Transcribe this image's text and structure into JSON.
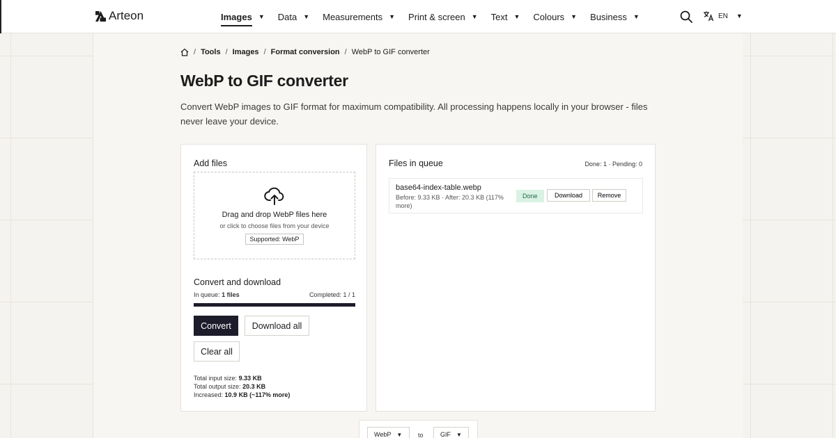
{
  "brand": {
    "name": "Arteon"
  },
  "nav": {
    "items": [
      {
        "label": "Images",
        "active": true
      },
      {
        "label": "Data"
      },
      {
        "label": "Measurements"
      },
      {
        "label": "Print & screen"
      },
      {
        "label": "Text"
      },
      {
        "label": "Colours"
      },
      {
        "label": "Business"
      }
    ],
    "caret": "▼"
  },
  "language": {
    "code": "EN"
  },
  "breadcrumb": {
    "sep": "/",
    "items": [
      "Tools",
      "Images",
      "Format conversion",
      "WebP to GIF converter"
    ]
  },
  "page": {
    "title": "WebP to GIF converter",
    "description": "Convert WebP images to GIF format for maximum compatibility. All processing happens locally in your browser - files never leave your device."
  },
  "add_files": {
    "title": "Add files",
    "drop_title": "Drag and drop WebP files here",
    "drop_sub": "or click to choose files from your device",
    "supported": "Supported: WebP"
  },
  "convert": {
    "title": "Convert and download",
    "in_queue_label": "In queue:",
    "in_queue_value": "1 files",
    "completed_label": "Completed:",
    "completed_value": "1 / 1",
    "progress": 1.0,
    "convert_label": "Convert",
    "download_all_label": "Download all",
    "clear_all_label": "Clear all"
  },
  "totals": {
    "input_label": "Total input size:",
    "input_value": "9.33 KB",
    "output_label": "Total output size:",
    "output_value": "20.3 KB",
    "increased_label": "Increased:",
    "increased_value": "10.9 KB (~117% more)"
  },
  "queue": {
    "title": "Files in queue",
    "counts": "Done: 1 · Pending: 0",
    "items": [
      {
        "name": "base64-index-table.webp",
        "meta": "Before: 9.33 KB · After: 20.3 KB (117% more)",
        "status": "Done",
        "download_label": "Download",
        "remove_label": "Remove"
      }
    ]
  },
  "switcher": {
    "from": "WebP",
    "to_label": "to",
    "to": "GIF"
  },
  "colors": {
    "accent": "#1c1c2b",
    "done_bg": "#d9f2e4",
    "done_text": "#1f6b45"
  }
}
